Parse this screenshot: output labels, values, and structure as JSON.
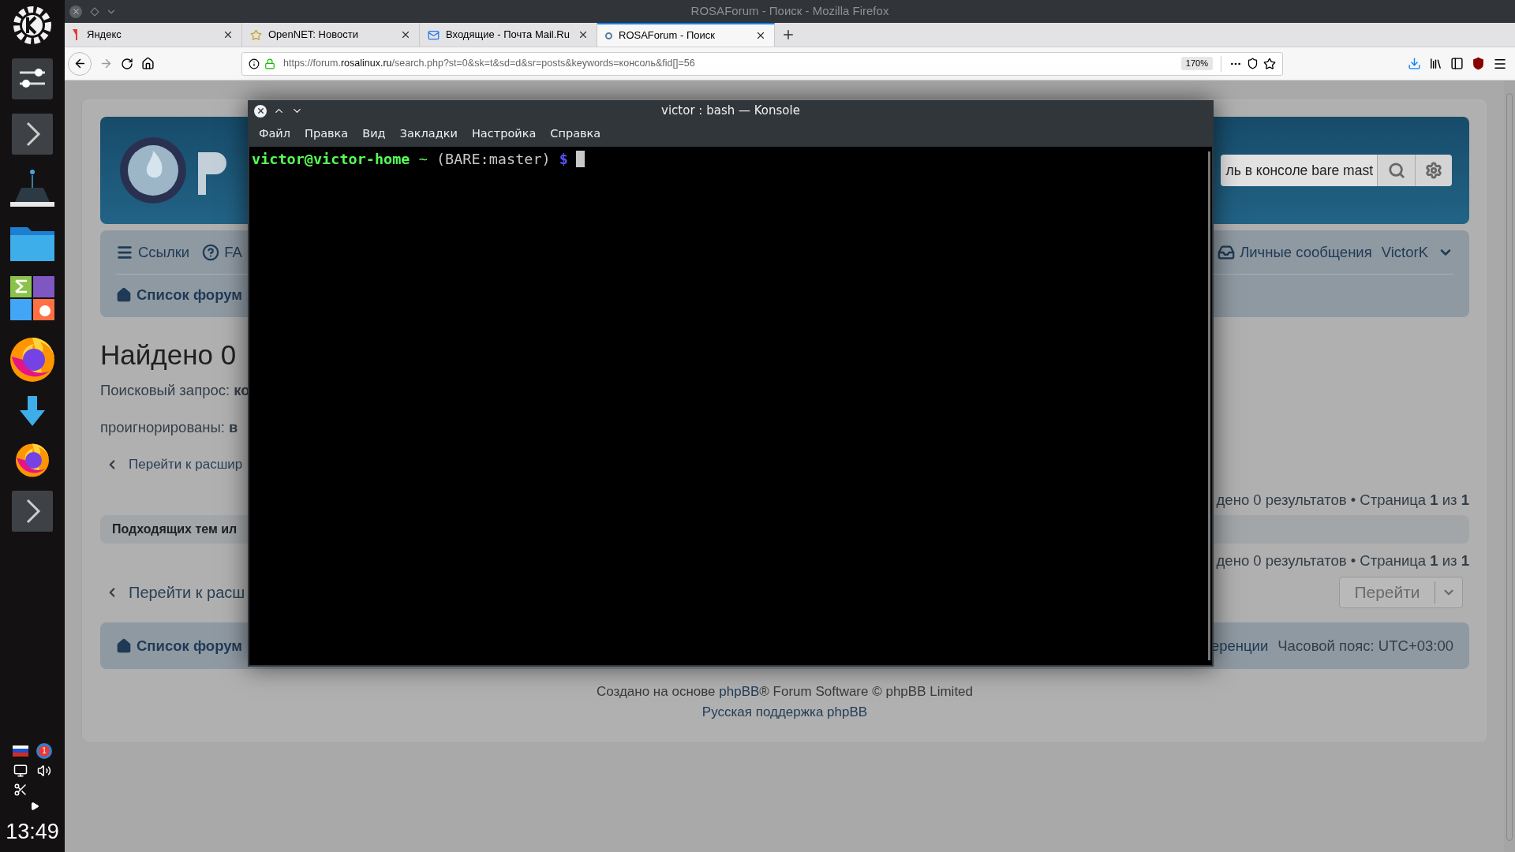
{
  "window": {
    "title": "ROSAForum - Поиск - Mozilla Firefox"
  },
  "dock": {
    "items": [
      {
        "kind": "kde"
      },
      {
        "kind": "mixer"
      },
      {
        "kind": "expand"
      },
      {
        "kind": "drive"
      },
      {
        "kind": "folder"
      },
      {
        "kind": "office"
      },
      {
        "kind": "firefox"
      },
      {
        "kind": "download"
      },
      {
        "kind": "firefox_small"
      },
      {
        "kind": "expand"
      }
    ],
    "badge": "1",
    "clock": "13:49"
  },
  "tabs": [
    {
      "label": "Яндекс",
      "kind": "yandex",
      "selected": false
    },
    {
      "label": "OpenNET: Новости",
      "kind": "star",
      "selected": false
    },
    {
      "label": "Входящие - Почта Mail.Ru",
      "kind": "mail",
      "selected": false
    },
    {
      "label": "ROSAForum - Поиск",
      "kind": "rosa",
      "selected": true
    }
  ],
  "address_bar": {
    "url_prefix": "https://forum.",
    "url_domain": "rosalinux.ru",
    "url_path": "/search.php?st=0&sk=t&sd=d&sr=posts&keywords=консоль&fid[]=56",
    "zoom": "170%"
  },
  "page": {
    "search_field": {
      "value": "ль в консоле bare mast"
    },
    "nav_left": [
      {
        "kind": "menu",
        "label": "Ссылки"
      },
      {
        "kind": "help",
        "label": "FA"
      }
    ],
    "nav_right": [
      {
        "kind": "inbox",
        "label": "Личные сообщения"
      },
      {
        "kind": "user",
        "label": "VictorK"
      }
    ],
    "breadcrumb": "Список форум",
    "heading": "Найдено 0",
    "query": "Поисковый запрос: **ко**",
    "ignored": "проигнорированы: **в**",
    "advanced_link_top": "Перейти к расшир",
    "pagination_top": "дено 0 результатов • Страница **1** из **1**",
    "notice": "Подходящих тем ил",
    "pagination_bottom": "дено 0 результатов • Страница **1** из **1**",
    "advanced_link_bottom": "Перейти к расш",
    "jump_button": "Перейти",
    "footer_left": "Список форум",
    "footer_right": [
      "еренции",
      "Часовой пояс: UTC+03:00"
    ],
    "credits": {
      "before": "Создано на основе ",
      "link": "phpBB",
      "after": "® Forum Software © phpBB Limited",
      "support": "Русская поддержка phpBB"
    }
  },
  "konsole": {
    "title": "victor : bash — Konsole",
    "menu": [
      "Файл",
      "Правка",
      "Вид",
      "Закладки",
      "Настройка",
      "Справка"
    ],
    "prompt": {
      "user_host": "victor@victor-home",
      "dir": "~",
      "branch": "(BARE:master)",
      "symbol": "$"
    }
  }
}
